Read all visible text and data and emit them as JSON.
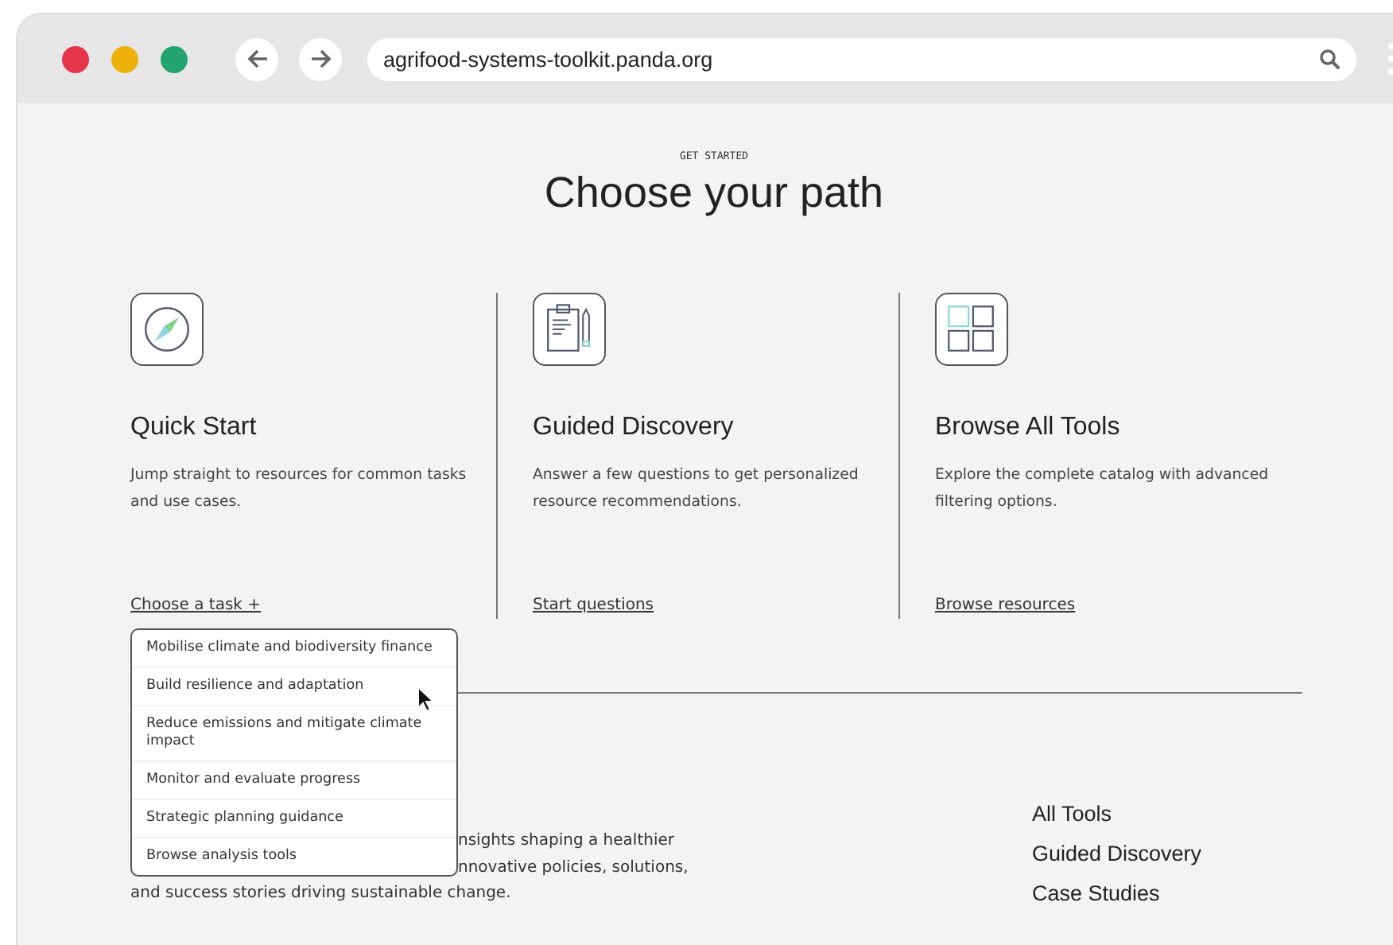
{
  "browser": {
    "url": "agrifood-systems-toolkit.panda.org"
  },
  "header": {
    "eyebrow": "GET STARTED",
    "title": "Choose your path"
  },
  "paths": [
    {
      "title": "Quick Start",
      "description": "Jump straight to resources for common tasks and use cases.",
      "link": "Choose a task +"
    },
    {
      "title": "Guided Discovery",
      "description": "Answer a few questions to get personalized resource recommendations.",
      "link": "Start questions"
    },
    {
      "title": "Browse All Tools",
      "description": "Explore the complete catalog with advanced filtering options.",
      "link": "Browse resources"
    }
  ],
  "task_menu": {
    "items": [
      "Mobilise climate and biodiversity finance",
      "Build resilience and adaptation",
      "Reduce emissions and mitigate climate impact",
      "Monitor and evaluate progress",
      "Strategic planning guidance",
      "Browse analysis tools"
    ]
  },
  "intro": {
    "lines": [
      "nsights shaping a healthier",
      "nnovative policies, solutions,",
      "and success stories driving sustainable change."
    ]
  },
  "footer_links": [
    "All Tools",
    "Guided Discovery",
    "Case Studies"
  ]
}
